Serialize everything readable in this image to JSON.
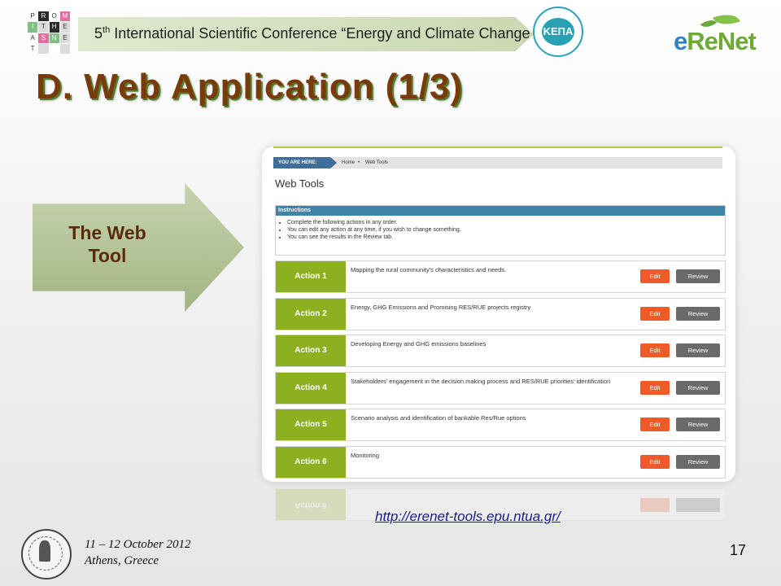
{
  "header": {
    "prometheas_letters": [
      "P",
      "R",
      "O",
      "M",
      "I",
      "T",
      "H",
      "E",
      "A",
      "S",
      "N",
      "E",
      "T",
      "",
      "",
      ""
    ],
    "conference_ordinal": "5",
    "conference_ordinal_sup": "th",
    "conference_title": " International Scientific Conference “Energy and Climate Change”",
    "kepa_logo": "ΚΕΠΑ",
    "erenet_logo_part1": "e",
    "erenet_logo_part2": "ReNet"
  },
  "slide": {
    "title": "D. Web Application (1/3)",
    "arrow_label_line1": "The Web",
    "arrow_label_line2": "Tool"
  },
  "webtool": {
    "you_are_here": "YOU ARE HERE:",
    "crumb_home": "Home",
    "crumb_sep": "•",
    "crumb_current": "Web Tools",
    "page_title": "Web Tools",
    "instructions_header": "Instructions",
    "instructions": [
      "Complete the following actions in any order.",
      "You can edit any action at any time, if you wish to change something.",
      "You can see the results in the Review tab."
    ],
    "edit_label": "Edit",
    "review_label": "Review",
    "actions": [
      {
        "label": "Action 1",
        "desc": "Mapping the rural community's characteristics and needs."
      },
      {
        "label": "Action 2",
        "desc": "Energy, GHG Emissions and Promising RES/RUE projects registry"
      },
      {
        "label": "Action 3",
        "desc": "Developing Energy and GHG emissions baselines"
      },
      {
        "label": "Action 4",
        "desc": "Stakeholders' engagement in the decision making process and RES/RUE priorities' identification"
      },
      {
        "label": "Action 5",
        "desc": "Scenario analysis and identification of bankable Res/Rue options"
      },
      {
        "label": "Action 6",
        "desc": "Monitoring"
      }
    ]
  },
  "url": "http://erenet-tools.epu.ntua.gr/",
  "footer": {
    "date_line1": "11 – 12 October 2012",
    "date_line2": "Athens, Greece",
    "page_number": "17"
  },
  "colors": {
    "action_green": "#8db021",
    "edit_orange": "#f05a28",
    "review_gray": "#6a6a6a",
    "instructions_blue": "#3f83a6",
    "title_brown": "#7a3b0c"
  }
}
